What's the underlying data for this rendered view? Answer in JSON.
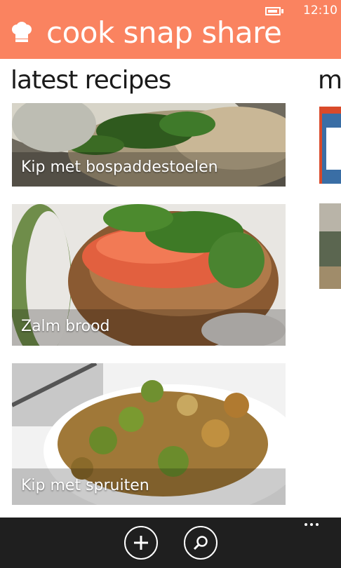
{
  "status_bar": {
    "time": "12:10",
    "battery_level": 0.7,
    "battery_charging": true
  },
  "header": {
    "app_title": "cook snap share",
    "icon": "chef-hat-icon",
    "background_color": "#fa8360"
  },
  "pivot": {
    "current_title": "latest recipes",
    "next_title_peek": "m"
  },
  "recipes": [
    {
      "title": "Kip met bospaddestoelen"
    },
    {
      "title": "Zalm brood"
    },
    {
      "title": "Kip met spruiten"
    }
  ],
  "app_bar": {
    "buttons": [
      {
        "icon": "add-icon"
      },
      {
        "icon": "search-icon"
      }
    ],
    "more_icon": "ellipsis-icon"
  }
}
